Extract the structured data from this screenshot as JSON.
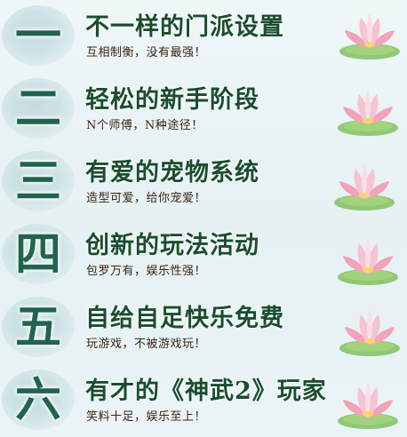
{
  "features": [
    {
      "numeral": "一",
      "title": "不一样的门派设置",
      "subtitle": "互相制衡，没有最强！"
    },
    {
      "numeral": "二",
      "title": "轻松的新手阶段",
      "subtitle": "N个师傅，N种途径！"
    },
    {
      "numeral": "三",
      "title": "有爱的宠物系统",
      "subtitle": "造型可爱，给你宠爱！"
    },
    {
      "numeral": "四",
      "title": "创新的玩法活动",
      "subtitle": "包罗万有，娱乐性强！"
    },
    {
      "numeral": "五",
      "title": "自给自足快乐免费",
      "subtitle": "玩游戏，不被游戏玩！"
    },
    {
      "numeral": "六",
      "title": "有才的《神武2》玩家",
      "subtitle": "笑料十足，娱乐至上！"
    }
  ],
  "colors": {
    "numeral": "#21634f",
    "title": "#1a4d2e",
    "subtitle": "#3a2412",
    "lotus_petal": "#f2a3b9",
    "lotus_leaf": "#7fbf5f"
  },
  "icons": [
    "lotus-flower-icon"
  ]
}
